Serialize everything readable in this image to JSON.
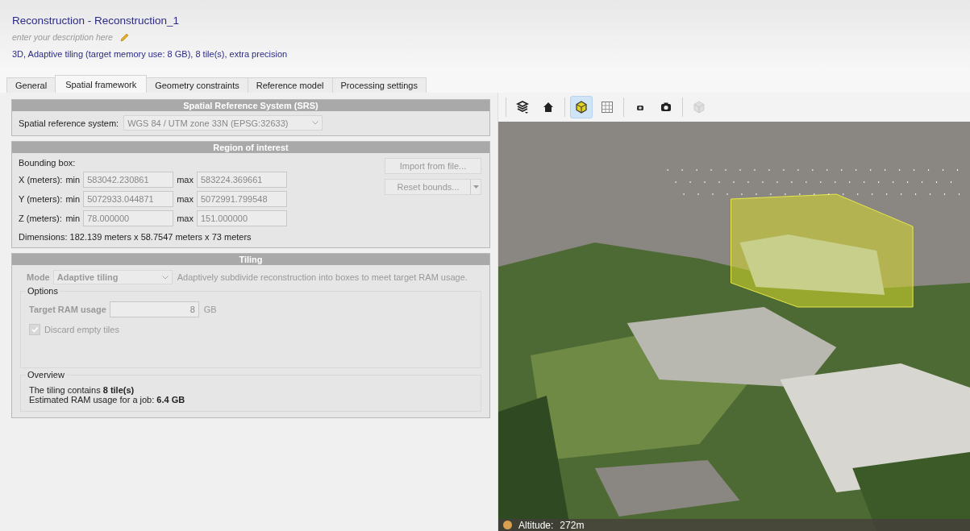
{
  "header": {
    "title": "Reconstruction - Reconstruction_1",
    "description_placeholder": "enter your description here",
    "summary": "3D, Adaptive tiling (target memory use: 8 GB), 8 tile(s), extra precision"
  },
  "tabs": [
    {
      "label": "General",
      "selected": false
    },
    {
      "label": "Spatial framework",
      "selected": true
    },
    {
      "label": "Geometry constraints",
      "selected": false
    },
    {
      "label": "Reference model",
      "selected": false
    },
    {
      "label": "Processing settings",
      "selected": false
    }
  ],
  "srs": {
    "title": "Spatial Reference System (SRS)",
    "label": "Spatial reference system:",
    "value": "WGS 84 / UTM zone 33N (EPSG:32633)"
  },
  "roi": {
    "title": "Region of interest",
    "bounding_box_label": "Bounding box:",
    "rows": [
      {
        "label": "X (meters):",
        "min_label": "min",
        "min": "583042.230861",
        "max_label": "max",
        "max": "583224.369661"
      },
      {
        "label": "Y (meters):",
        "min_label": "min",
        "min": "5072933.044871",
        "max_label": "max",
        "max": "5072991.799548"
      },
      {
        "label": "Z (meters):",
        "min_label": "min",
        "min": "78.000000",
        "max_label": "max",
        "max": "151.000000"
      }
    ],
    "dimensions": "Dimensions: 182.139 meters x 58.7547 meters x 73 meters",
    "buttons": [
      {
        "label": "Import from file...",
        "kind": "plain"
      },
      {
        "label": "Reset bounds...",
        "kind": "split"
      }
    ]
  },
  "tiling": {
    "title": "Tiling",
    "mode_label": "Mode",
    "mode": "Adaptive tiling",
    "mode_hint": "Adaptively subdivide reconstruction into boxes to meet target RAM usage.",
    "options_title": "Options",
    "target_label": "Target RAM usage",
    "target_value": "8",
    "target_unit": "GB",
    "discard": {
      "label": "Discard empty tiles",
      "checked": true
    },
    "overview_title": "Overview",
    "overview_lines": [
      "The tiling contains **8 tile(s)**",
      "Estimated RAM usage for a job: **6.4 GB**"
    ]
  },
  "viewer": {
    "toolbar": [
      {
        "kind": "layers",
        "selected": false,
        "disabled": false
      },
      {
        "kind": "home",
        "selected": false,
        "disabled": false
      },
      {
        "kind": "box",
        "selected": true,
        "disabled": false
      },
      {
        "kind": "grid",
        "selected": false,
        "disabled": false
      },
      {
        "kind": "camera-small",
        "selected": false,
        "disabled": false
      },
      {
        "kind": "camera",
        "selected": false,
        "disabled": false
      },
      {
        "kind": "cube",
        "selected": false,
        "disabled": true
      }
    ],
    "status": {
      "label": "Altitude:",
      "value": "272m"
    }
  }
}
